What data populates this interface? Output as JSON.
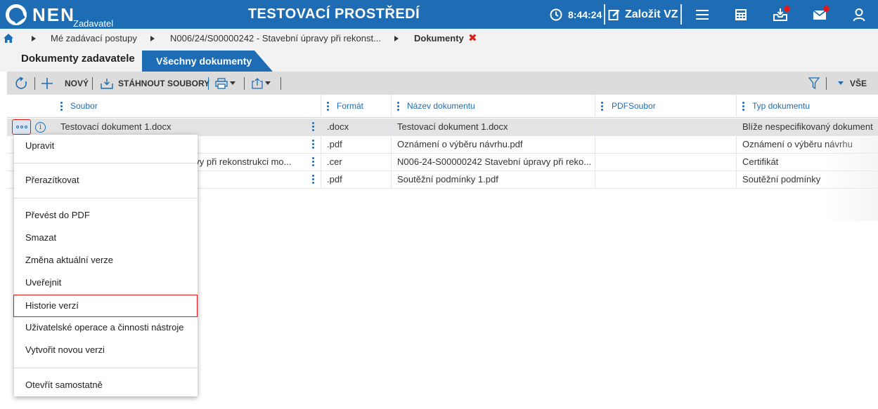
{
  "header": {
    "logo_text": "NEN",
    "logo_sub": "Zadavatel",
    "environment": "TESTOVACÍ PROSTŘEDÍ",
    "time": "8:44:24",
    "create_label": "Založit VZ",
    "icons": [
      "clock-icon",
      "edit-icon",
      "menu-icon",
      "calculator-icon",
      "inbox-icon",
      "mail-icon",
      "user-icon"
    ],
    "colors": {
      "primary": "#1e6db4",
      "alert": "#e0191d"
    }
  },
  "breadcrumb": {
    "items": [
      "Mé zadávací postupy",
      "N006/24/S00000242 - Stavební úpravy při rekonst...",
      "Dokumenty"
    ],
    "close_glyph": "✖"
  },
  "tabs": [
    {
      "label": "Dokumenty zadavatele",
      "active": true
    },
    {
      "label": "Všechny dokumenty",
      "active": false
    }
  ],
  "toolbar": {
    "new_label": "NOVÝ",
    "download_label": "STÁHNOUT SOUBORY",
    "filter_label": "VŠE"
  },
  "table": {
    "columns": [
      "Soubor",
      "Formát",
      "Název dokumentu",
      "PDFSoubor",
      "Typ dokumentu"
    ],
    "rows": [
      {
        "soubor": "Testovací dokument 1.docx",
        "format": ".docx",
        "nazev": "Testovací dokument 1.docx",
        "pdf": "",
        "typ": "Blíže nespecifikovaný dokument",
        "selected": true
      },
      {
        "soubor": "",
        "format": ".pdf",
        "nazev": "Oznámení o výběru návrhu.pdf",
        "pdf": "",
        "typ": "Oznámení o výběru návrhu",
        "selected": false
      },
      {
        "soubor": "avy při rekonstrukci mo...",
        "format": ".cer",
        "nazev": "N006-24-S00000242 Stavební úpravy při reko...",
        "pdf": "",
        "typ": "Certifikát",
        "selected": false
      },
      {
        "soubor": "",
        "format": ".pdf",
        "nazev": "Soutěžní podmínky 1.pdf",
        "pdf": "",
        "typ": "Soutěžní podmínky",
        "selected": false
      }
    ]
  },
  "context_menu": {
    "items": [
      "Upravit",
      "Přerazítkovat",
      "Převést do PDF",
      "Smazat",
      "Změna aktuální verze",
      "Uveřejnit",
      "Historie verzí",
      "Uživatelské operace a činnosti nástroje",
      "Vytvořit novou verzi",
      "Otevřít samostatně"
    ],
    "highlighted": "Historie verzí"
  }
}
